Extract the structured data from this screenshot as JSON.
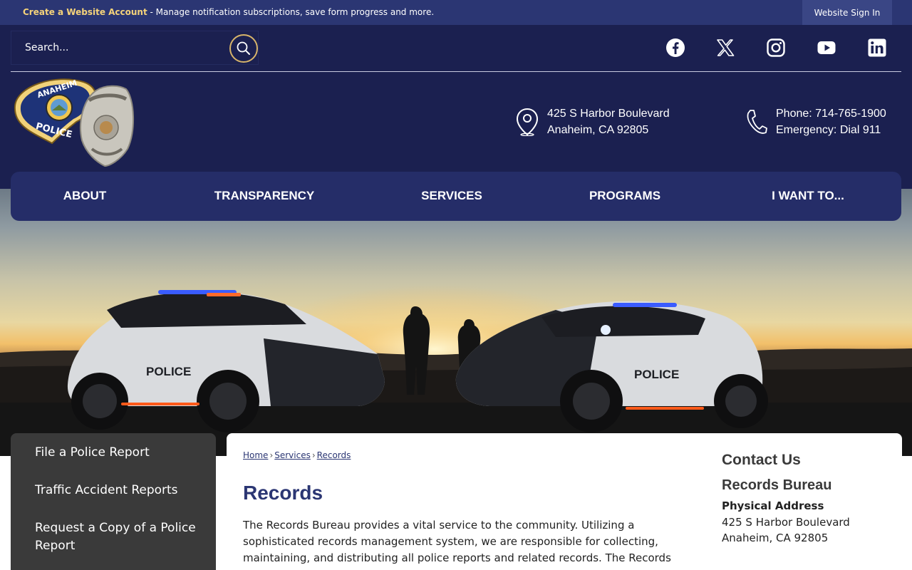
{
  "top_bar": {
    "account_link": "Create a Website Account",
    "account_desc": " - Manage notification subscriptions, save form progress and more.",
    "sign_in": "Website Sign In"
  },
  "header": {
    "search_placeholder": "Search...",
    "social_icons": [
      "facebook-icon",
      "x-icon",
      "instagram-icon",
      "youtube-icon",
      "linkedin-icon"
    ],
    "address_line1": "425 S Harbor Boulevard",
    "address_line2": "Anaheim, CA 92805",
    "phone_line1": "Phone: 714-765-1900",
    "phone_line2": "Emergency: Dial 911",
    "logo_text_top": "ANAHEIM",
    "logo_text_bottom": "POLICE"
  },
  "nav": {
    "items": [
      "ABOUT",
      "TRANSPARENCY",
      "SERVICES",
      "PROGRAMS",
      "I WANT TO..."
    ]
  },
  "sidebar": {
    "items": [
      "File a Police Report",
      "Traffic Accident Reports",
      "Request a Copy of a Police Report"
    ]
  },
  "breadcrumb": [
    "Home",
    "Services",
    "Records"
  ],
  "page": {
    "title": "Records",
    "intro": "The Records Bureau provides a vital service to the community. Utilizing a sophisticated records management system, we are responsible for collecting, maintaining, and distributing all police reports and related records. The Records"
  },
  "contact": {
    "heading": "Contact Us",
    "bureau": "Records Bureau",
    "address_label": "Physical Address",
    "address_line1": "425 S Harbor Boulevard",
    "address_line2": "Anaheim, CA 92805"
  },
  "colors": {
    "navy": "#1b2050",
    "nav_bg": "#252d68",
    "accent_gold": "#d7b46a",
    "title_blue": "#2b3673",
    "sidebar_bg": "#3a3a3a"
  }
}
